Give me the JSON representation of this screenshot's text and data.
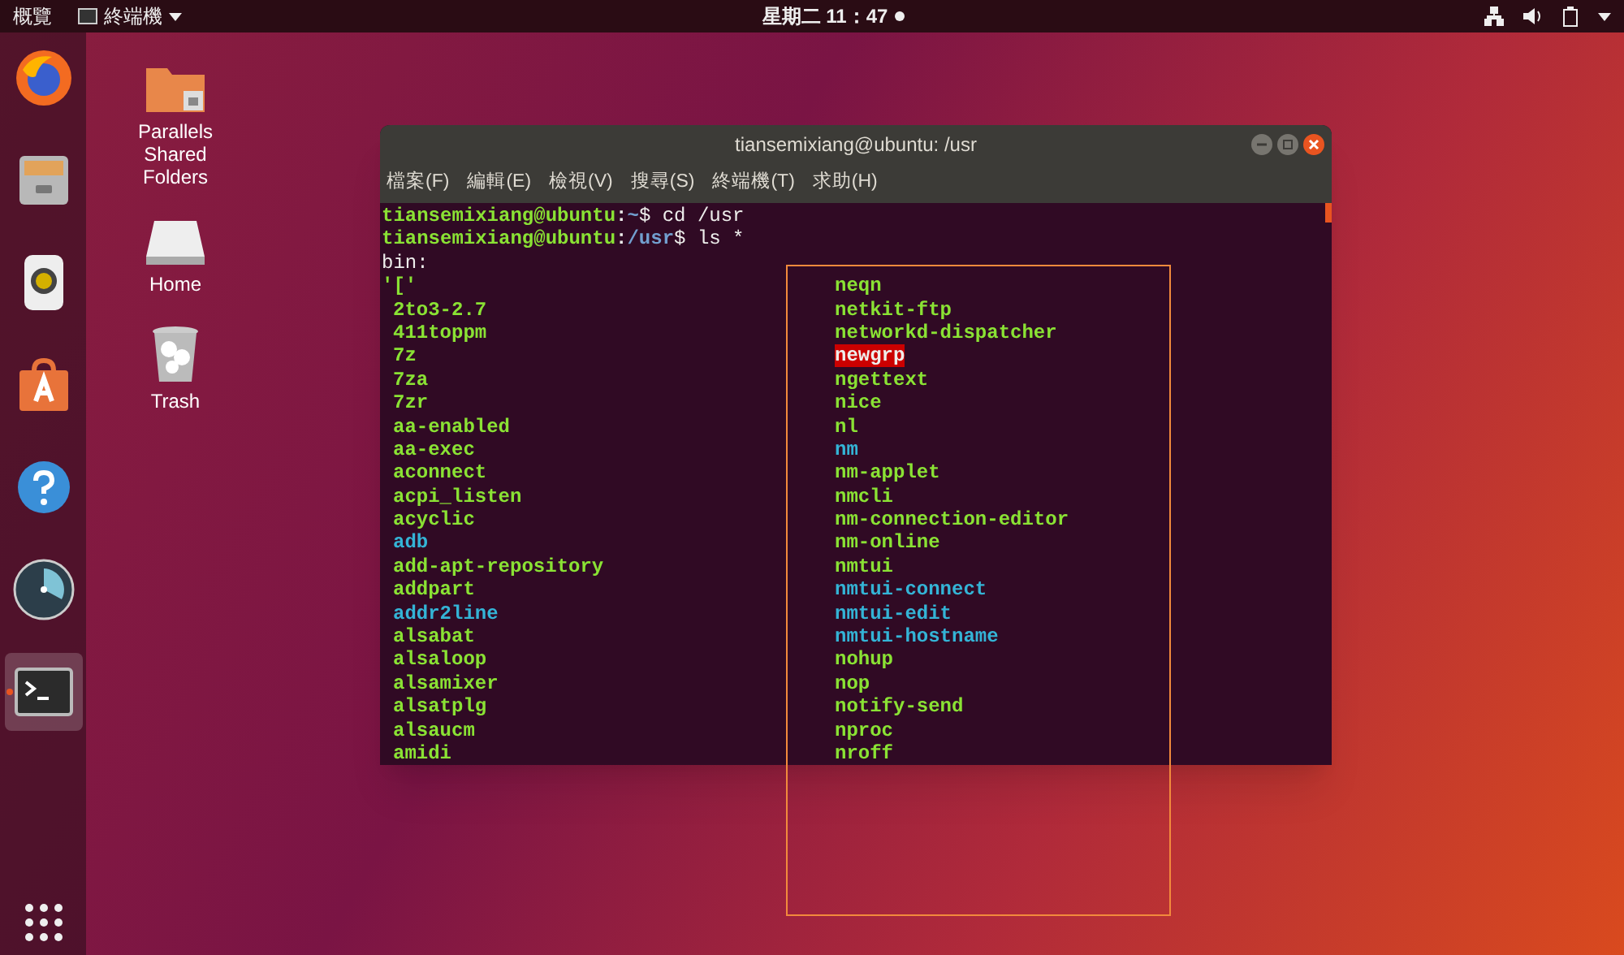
{
  "top_bar": {
    "activities": "概覽",
    "app_menu": "終端機",
    "clock": "星期二 11：47"
  },
  "dock": {
    "items": [
      {
        "kind": "browser",
        "selected": false
      },
      {
        "kind": "files",
        "selected": false
      },
      {
        "kind": "music",
        "selected": false
      },
      {
        "kind": "software",
        "selected": false
      },
      {
        "kind": "help",
        "selected": false
      },
      {
        "kind": "gauge",
        "selected": false
      },
      {
        "kind": "terminal",
        "selected": true
      }
    ]
  },
  "desktop_icons": [
    {
      "kind": "shared-folder",
      "label": "Parallels Shared Folders"
    },
    {
      "kind": "drive",
      "label": "Home"
    },
    {
      "kind": "trash",
      "label": "Trash"
    }
  ],
  "terminal": {
    "title": "tiansemixiang@ubuntu: /usr",
    "menu": [
      "檔案(F)",
      "編輯(E)",
      "檢視(V)",
      "搜尋(S)",
      "終端機(T)",
      "求助(H)"
    ],
    "prompts": [
      {
        "user_host": "tiansemixiang@ubuntu",
        "separator": ":",
        "path": "~",
        "command": "$ cd /usr"
      },
      {
        "user_host": "tiansemixiang@ubuntu",
        "separator": ":",
        "path": "/usr",
        "command": "$ ls *"
      }
    ],
    "heading": "bin:",
    "columns": [
      [
        {
          "name": "'['",
          "kind": "quoted"
        },
        {
          "name": "2to3-2.7",
          "kind": "exec"
        },
        {
          "name": "411toppm",
          "kind": "exec"
        },
        {
          "name": "7z",
          "kind": "exec"
        },
        {
          "name": "7za",
          "kind": "exec"
        },
        {
          "name": "7zr",
          "kind": "exec"
        },
        {
          "name": "aa-enabled",
          "kind": "exec"
        },
        {
          "name": "aa-exec",
          "kind": "exec"
        },
        {
          "name": "aconnect",
          "kind": "exec"
        },
        {
          "name": "acpi_listen",
          "kind": "exec"
        },
        {
          "name": "acyclic",
          "kind": "exec"
        },
        {
          "name": "adb",
          "kind": "link"
        },
        {
          "name": "add-apt-repository",
          "kind": "exec"
        },
        {
          "name": "addpart",
          "kind": "exec"
        },
        {
          "name": "addr2line",
          "kind": "link"
        },
        {
          "name": "alsabat",
          "kind": "exec"
        },
        {
          "name": "alsaloop",
          "kind": "exec"
        },
        {
          "name": "alsamixer",
          "kind": "exec"
        },
        {
          "name": "alsatplg",
          "kind": "exec"
        },
        {
          "name": "alsaucm",
          "kind": "exec"
        },
        {
          "name": "amidi",
          "kind": "exec"
        }
      ],
      [
        {
          "name": "neqn",
          "kind": "exec"
        },
        {
          "name": "netkit-ftp",
          "kind": "exec"
        },
        {
          "name": "networkd-dispatcher",
          "kind": "exec"
        },
        {
          "name": "newgrp",
          "kind": "setuid"
        },
        {
          "name": "ngettext",
          "kind": "exec"
        },
        {
          "name": "nice",
          "kind": "exec"
        },
        {
          "name": "nl",
          "kind": "exec"
        },
        {
          "name": "nm",
          "kind": "link"
        },
        {
          "name": "nm-applet",
          "kind": "exec"
        },
        {
          "name": "nmcli",
          "kind": "exec"
        },
        {
          "name": "nm-connection-editor",
          "kind": "exec"
        },
        {
          "name": "nm-online",
          "kind": "exec"
        },
        {
          "name": "nmtui",
          "kind": "exec"
        },
        {
          "name": "nmtui-connect",
          "kind": "link"
        },
        {
          "name": "nmtui-edit",
          "kind": "link"
        },
        {
          "name": "nmtui-hostname",
          "kind": "link"
        },
        {
          "name": "nohup",
          "kind": "exec"
        },
        {
          "name": "nop",
          "kind": "exec"
        },
        {
          "name": "notify-send",
          "kind": "exec"
        },
        {
          "name": "nproc",
          "kind": "exec"
        },
        {
          "name": "nroff",
          "kind": "exec"
        }
      ]
    ]
  }
}
